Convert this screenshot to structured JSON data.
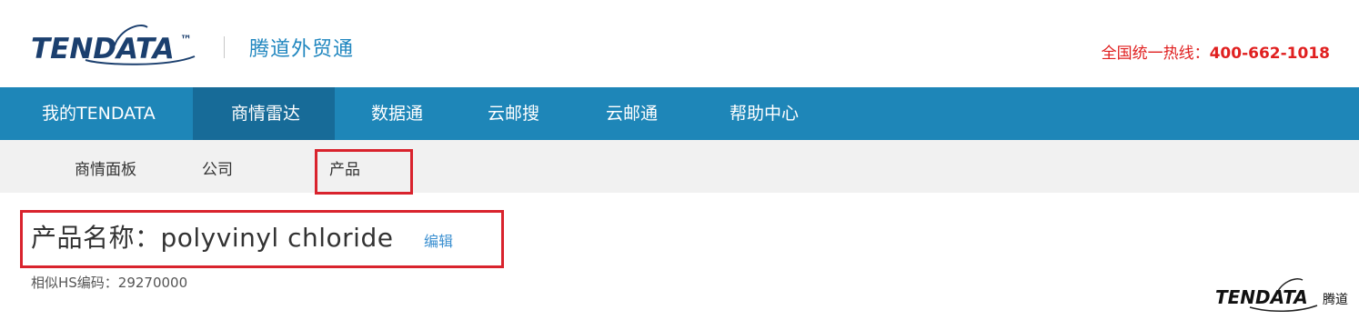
{
  "header": {
    "logo_text": "TENDATA",
    "logo_mark": "™",
    "product_name": "腾道外贸通",
    "hotline_label": "全国统一热线：",
    "hotline_number": "400-662-1018"
  },
  "main_nav": {
    "items": [
      {
        "label": "我的TENDATA"
      },
      {
        "label": "商情雷达"
      },
      {
        "label": "数据通"
      },
      {
        "label": "云邮搜"
      },
      {
        "label": "云邮通"
      },
      {
        "label": "帮助中心"
      }
    ],
    "active_index": 1
  },
  "sub_nav": {
    "items": [
      {
        "label": "商情面板"
      },
      {
        "label": "公司"
      },
      {
        "label": "产品"
      }
    ],
    "active_index": 2
  },
  "content": {
    "title": "产品名称：polyvinyl chloride",
    "edit_label": "编辑",
    "hs_code": "相似HS编码：29270000"
  },
  "watermark": {
    "logo_text": "TENDATA",
    "brand_cn": "腾道"
  },
  "colors": {
    "nav_bg": "#1e86b8",
    "nav_active_bg": "#176b98",
    "brand_blue": "#1f86bf",
    "highlight_red": "#d9232d",
    "hotline_red": "#e02020"
  }
}
